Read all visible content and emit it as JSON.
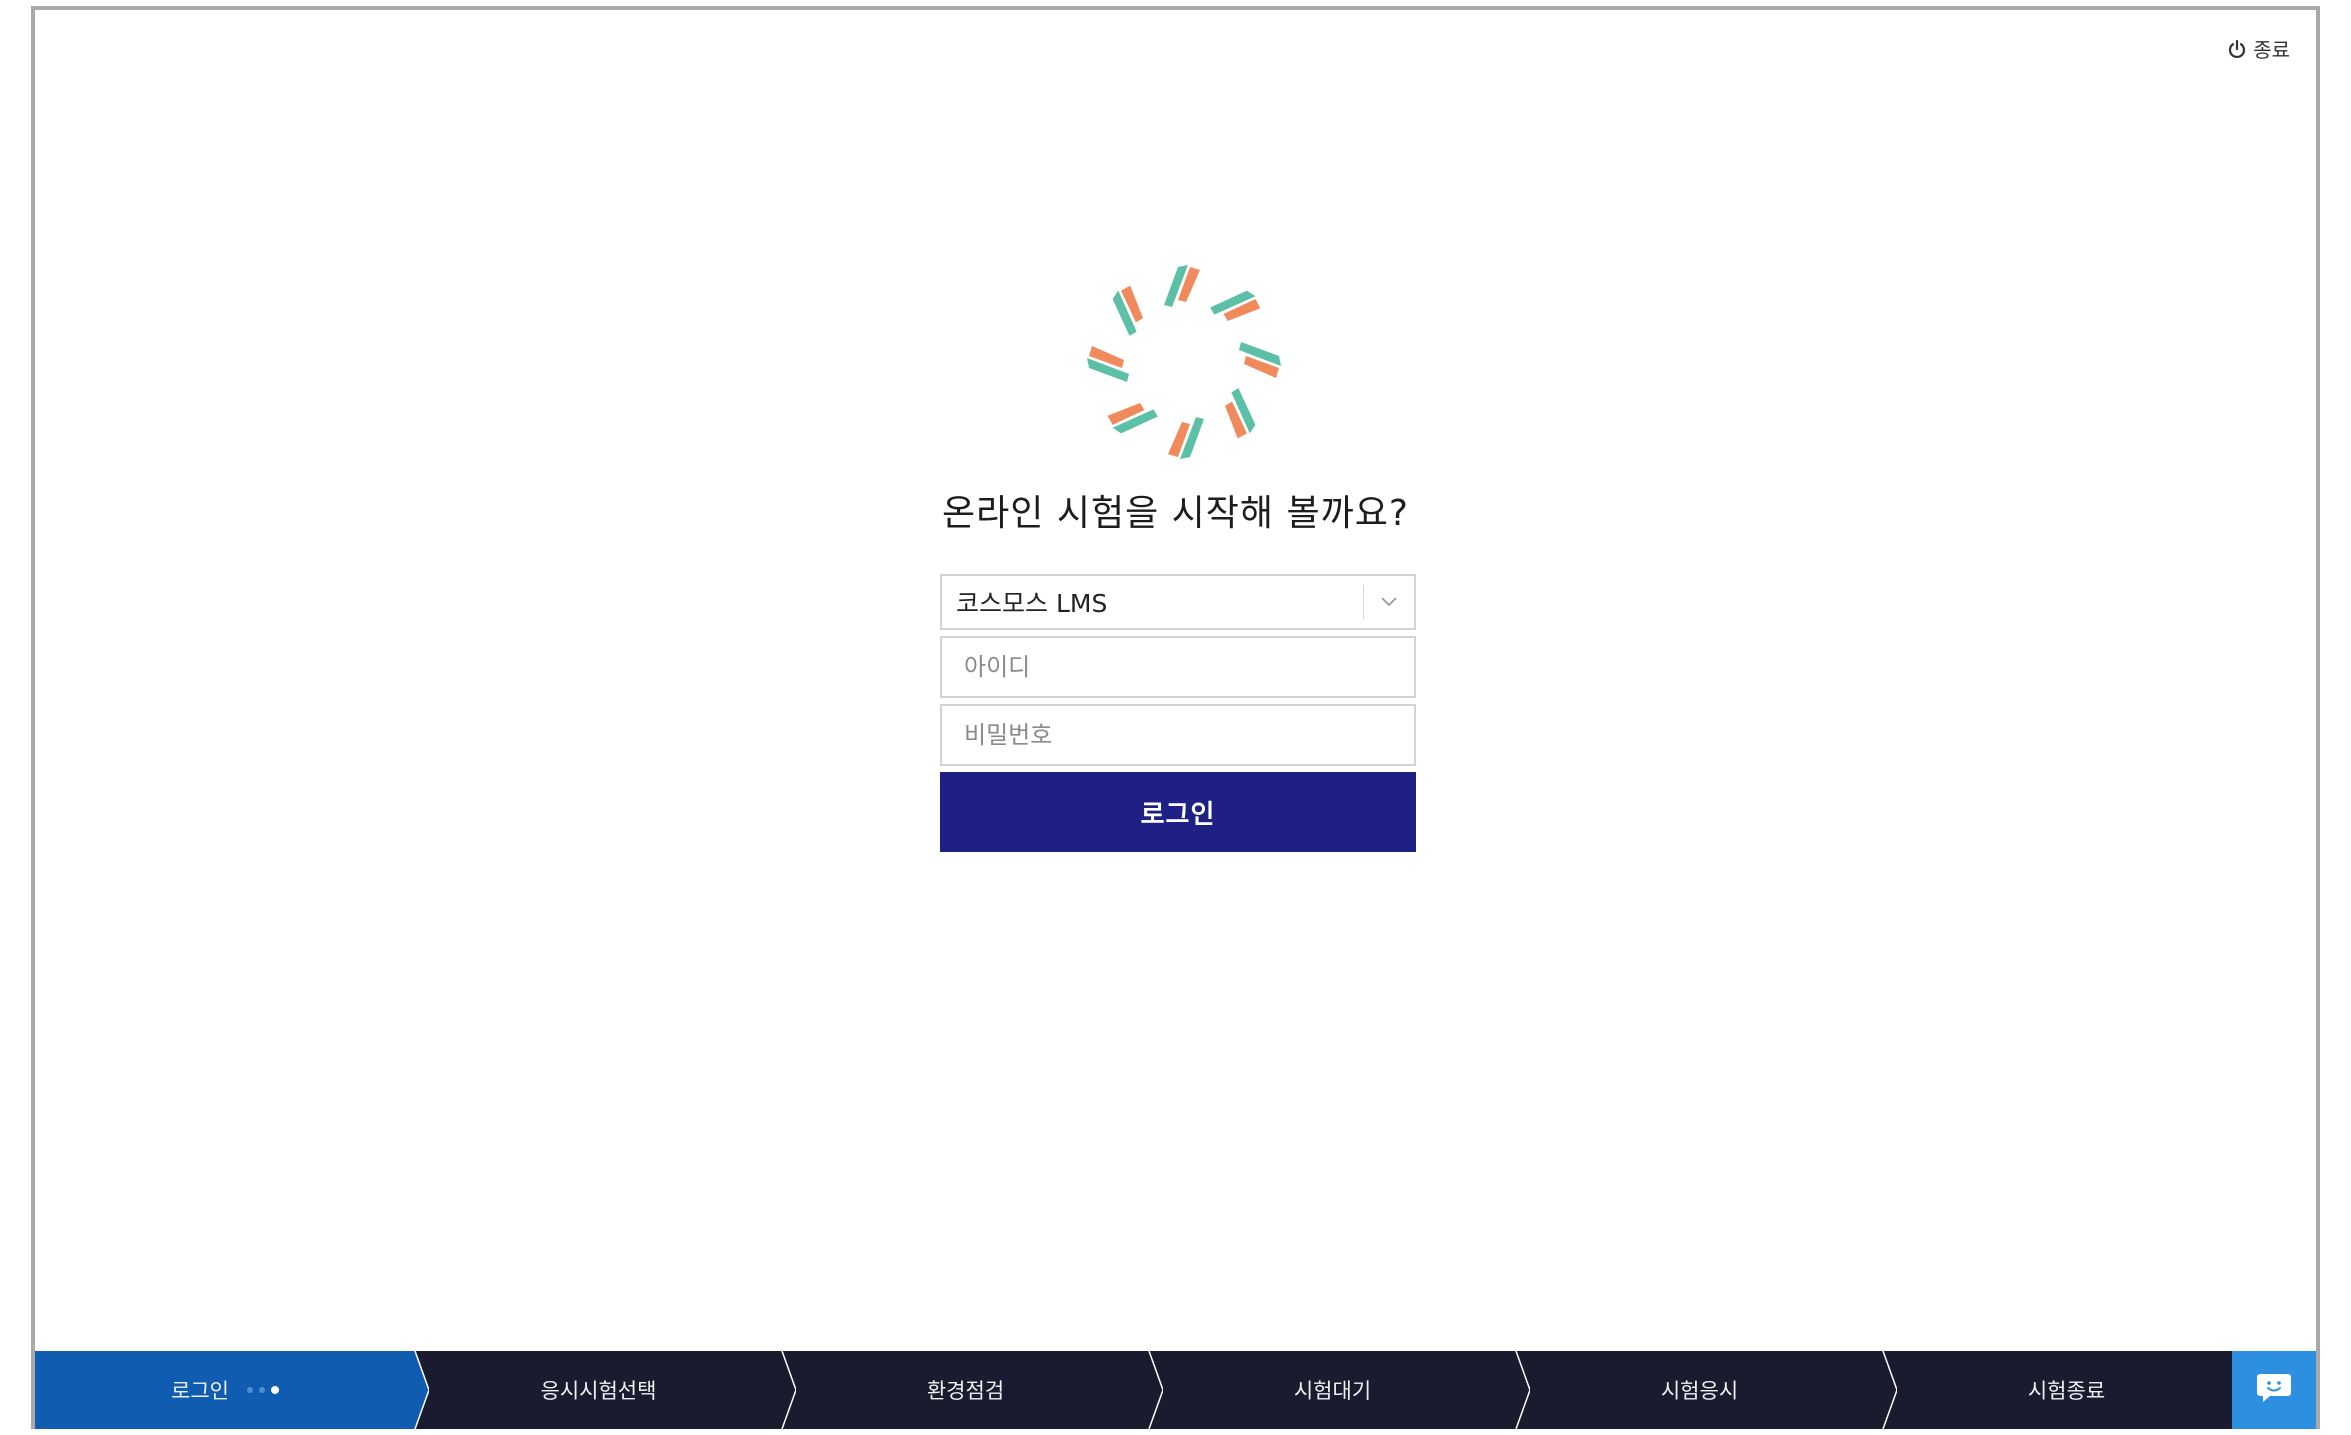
{
  "header": {
    "exit_label": "종료",
    "exit_icon": "power-icon"
  },
  "logo": {
    "icon": "cosmos-flower-logo",
    "colors": {
      "teal": "#5cc0a6",
      "orange": "#f08a5c"
    }
  },
  "main": {
    "headline": "온라인 시험을 시작해 볼까요?"
  },
  "form": {
    "site_select": {
      "value": "코스모스 LMS",
      "icon": "chevron-down-icon"
    },
    "id_field": {
      "placeholder": "아이디",
      "value": ""
    },
    "password_field": {
      "placeholder": "비밀번호",
      "value": ""
    },
    "login_button": "로그인",
    "button_color": "#1e2085"
  },
  "steps": [
    {
      "label": "로그인",
      "active": true
    },
    {
      "label": "응시시험선택",
      "active": false
    },
    {
      "label": "환경점검",
      "active": false
    },
    {
      "label": "시험대기",
      "active": false
    },
    {
      "label": "시험응시",
      "active": false
    },
    {
      "label": "시험종료",
      "active": false
    }
  ],
  "colors": {
    "step_active": "#0f5cb0",
    "step_bar": "#1a1b2e",
    "chat_button": "#2d8fe0"
  },
  "chat": {
    "icon": "chat-bubble-icon"
  }
}
